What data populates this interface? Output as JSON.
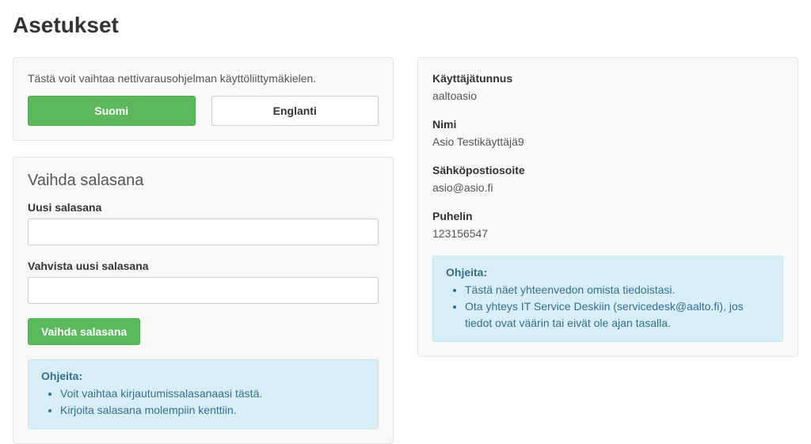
{
  "page_title": "Asetukset",
  "language_panel": {
    "description": "Tästä voit vaihtaa nettivarausohjelman käyttöliittymäkielen.",
    "button_fi": "Suomi",
    "button_en": "Englanti"
  },
  "password_panel": {
    "heading": "Vaihda salasana",
    "new_password_label": "Uusi salasana",
    "confirm_password_label": "Vahvista uusi salasana",
    "submit_label": "Vaihda salasana",
    "help": {
      "title": "Ohjeita:",
      "items": [
        "Voit vaihtaa kirjautumissalasanaasi tästä.",
        "Kirjoita salasana molempiin kenttiin."
      ]
    }
  },
  "user_panel": {
    "username_label": "Käyttäjätunnus",
    "username_value": "aaltoasio",
    "name_label": "Nimi",
    "name_value": "Asio Testikäyttäjä9",
    "email_label": "Sähköpostiosoite",
    "email_value": "asio@asio.fi",
    "phone_label": "Puhelin",
    "phone_value": "123156547",
    "help": {
      "title": "Ohjeita:",
      "items": [
        "Tästä näet yhteenvedon omista tiedoistasi.",
        "Ota yhteys IT Service Deskiin (servicedesk@aalto.fi), jos tiedot ovat väärin tai eivät ole ajan tasalla."
      ]
    }
  }
}
